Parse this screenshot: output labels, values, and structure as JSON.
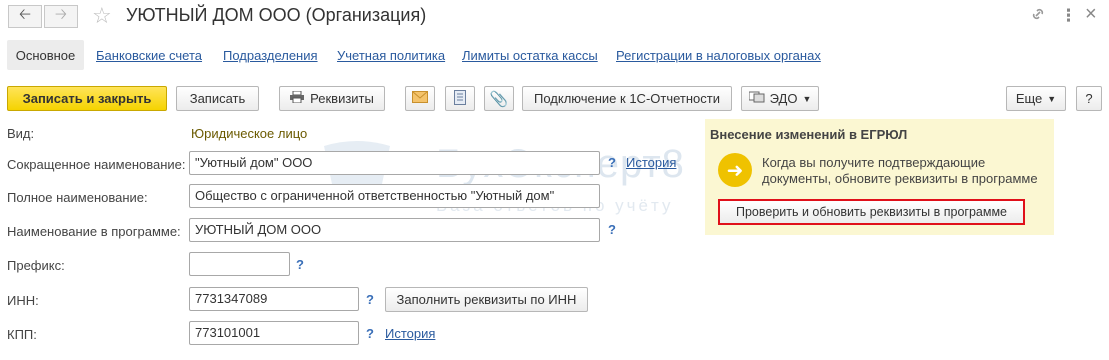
{
  "window": {
    "title": "УЮТНЫЙ ДОМ ООО (Организация)",
    "back_icon": "arrow-left-icon",
    "forward_icon": "arrow-right-icon",
    "favorite_icon": "star-icon",
    "link_icon": "link-icon",
    "menu_icon": "more-vertical-icon",
    "close_icon": "close-icon"
  },
  "tabs": [
    {
      "label": "Основное",
      "active": true
    },
    {
      "label": "Банковские счета"
    },
    {
      "label": "Подразделения"
    },
    {
      "label": "Учетная политика"
    },
    {
      "label": "Лимиты остатка кассы"
    },
    {
      "label": "Регистрации в налоговых органах"
    }
  ],
  "toolbar": {
    "save_close": "Записать и закрыть",
    "save": "Записать",
    "requisites": "Реквизиты",
    "connect_reporting": "Подключение к 1С-Отчетности",
    "edo": "ЭДО",
    "more": "Еще",
    "help": "?",
    "accent_color": "#f5d300"
  },
  "form": {
    "kind_label": "Вид:",
    "kind_value": "Юридическое лицо",
    "short_name_label": "Сокращенное наименование:",
    "short_name_value": "\"Уютный дом\" ООО",
    "full_name_label": "Полное наименование:",
    "full_name_value": "Общество с ограниченной ответственностью \"Уютный дом\"",
    "program_name_label": "Наименование в программе:",
    "program_name_value": "УЮТНЫЙ ДОМ ООО",
    "prefix_label": "Префикс:",
    "prefix_value": "",
    "inn_label": "ИНН:",
    "inn_value": "7731347089",
    "fill_by_inn": "Заполнить реквизиты по ИНН",
    "kpp_label": "КПП:",
    "kpp_value": "773101001",
    "history": "История",
    "help_mark": "?"
  },
  "watermark": {
    "brand": "БухЭксперт8",
    "tagline": "База ответов по учёту"
  },
  "egrul_panel": {
    "title": "Внесение изменений в ЕГРЮЛ",
    "text": "Когда вы получите подтверждающие документы, обновите реквизиты в программе",
    "button": "Проверить и обновить реквизиты в программе",
    "highlight_color": "#e0101a"
  }
}
